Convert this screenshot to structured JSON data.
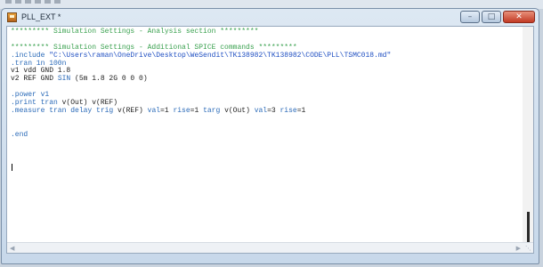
{
  "window": {
    "title": "PLL_EXT *",
    "buttons": {
      "minimize": "–",
      "maximize": "□",
      "close": "✕"
    }
  },
  "editor": {
    "lines": [
      [
        {
          "t": "********* Simulation Settings - Analysis section *********",
          "c": "cm"
        }
      ],
      [
        {
          "t": "",
          "c": ""
        }
      ],
      [
        {
          "t": "********* Simulation Settings - Additional SPICE commands *********",
          "c": "cm"
        }
      ],
      [
        {
          "t": ".include ",
          "c": "kw"
        },
        {
          "t": "\"C:\\Users\\raman\\OneDrive\\Desktop\\WeSendit\\TK138982\\TK138982\\CODE\\PLL\\TSMC018.md\"",
          "c": "str"
        }
      ],
      [
        {
          "t": ".tran 1n 100n",
          "c": "kw"
        }
      ],
      [
        {
          "t": "v1 vdd GND 1.8",
          "c": ""
        }
      ],
      [
        {
          "t": "v2 REF GND ",
          "c": ""
        },
        {
          "t": "SIN",
          "c": "kw"
        },
        {
          "t": " (5m 1.8 2G 0 0 0)",
          "c": ""
        }
      ],
      [
        {
          "t": "",
          "c": ""
        }
      ],
      [
        {
          "t": ".power v1",
          "c": "kw"
        }
      ],
      [
        {
          "t": ".print tran ",
          "c": "kw"
        },
        {
          "t": "v(Out) v(REF)",
          "c": ""
        }
      ],
      [
        {
          "t": ".measure tran delay trig ",
          "c": "kw"
        },
        {
          "t": "v(REF) ",
          "c": ""
        },
        {
          "t": "val",
          "c": "kw"
        },
        {
          "t": "=1 ",
          "c": ""
        },
        {
          "t": "rise",
          "c": "kw"
        },
        {
          "t": "=1 ",
          "c": ""
        },
        {
          "t": "targ ",
          "c": "kw"
        },
        {
          "t": "v(Out) ",
          "c": ""
        },
        {
          "t": "val",
          "c": "kw"
        },
        {
          "t": "=3 ",
          "c": ""
        },
        {
          "t": "rise",
          "c": "kw"
        },
        {
          "t": "=1",
          "c": ""
        }
      ],
      [
        {
          "t": "",
          "c": ""
        }
      ],
      [
        {
          "t": "",
          "c": ""
        }
      ],
      [
        {
          "t": ".end",
          "c": "kw"
        }
      ]
    ]
  },
  "icons": {
    "app": "netlist-file-icon",
    "scroll_left": "arrow-left-icon",
    "scroll_right": "arrow-right-icon",
    "resize": "resize-grip-icon"
  },
  "colors": {
    "comment": "#3aa14f",
    "keyword": "#2a6ab8",
    "string": "#1f4fc2",
    "close_button": "#c23a24"
  }
}
